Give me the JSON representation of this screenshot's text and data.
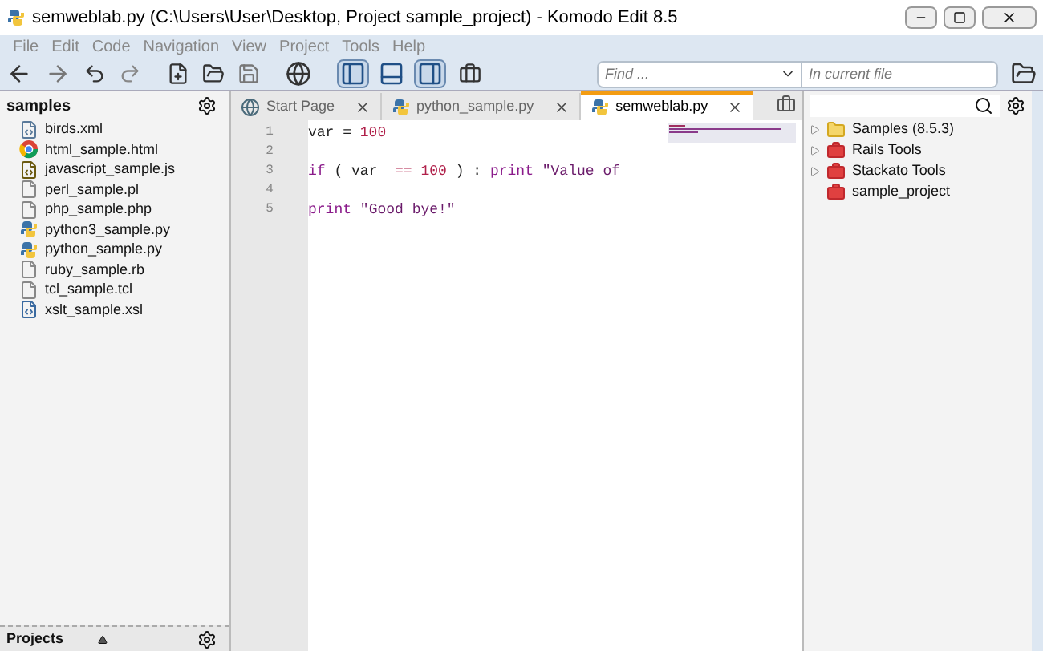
{
  "window": {
    "title": "semweblab.py (C:\\Users\\User\\Desktop, Project sample_project) - Komodo Edit 8.5"
  },
  "menu": [
    "File",
    "Edit",
    "Code",
    "Navigation",
    "View",
    "Project",
    "Tools",
    "Help"
  ],
  "toolbar": {
    "panes": [
      {
        "kind": "left",
        "selected": true
      },
      {
        "kind": "bottom",
        "selected": false
      },
      {
        "kind": "right",
        "selected": true
      }
    ],
    "find": {
      "placeholder": "Find ..."
    },
    "scope": {
      "placeholder": "In current file"
    }
  },
  "left_panel": {
    "title": "samples",
    "files": [
      {
        "name": "birds.xml",
        "kind": "xml"
      },
      {
        "name": "html_sample.html",
        "kind": "html"
      },
      {
        "name": "javascript_sample.js",
        "kind": "js"
      },
      {
        "name": "perl_sample.pl",
        "kind": "plain"
      },
      {
        "name": "php_sample.php",
        "kind": "plain"
      },
      {
        "name": "python3_sample.py",
        "kind": "python"
      },
      {
        "name": "python_sample.py",
        "kind": "python"
      },
      {
        "name": "ruby_sample.rb",
        "kind": "plain"
      },
      {
        "name": "tcl_sample.tcl",
        "kind": "plain"
      },
      {
        "name": "xslt_sample.xsl",
        "kind": "xsl"
      }
    ],
    "footer": "Projects"
  },
  "tabs": [
    {
      "label": "Start Page",
      "kind": "start",
      "selected": false
    },
    {
      "label": "python_sample.py",
      "kind": "python",
      "selected": false
    },
    {
      "label": "semweblab.py",
      "kind": "python",
      "selected": true
    }
  ],
  "editor": {
    "lines": [
      {
        "number": "1",
        "tokens": [
          {
            "text": "var = ",
            "kind": "plain"
          },
          {
            "text": "100",
            "kind": "number"
          }
        ]
      },
      {
        "number": "2"
      },
      {
        "number": "3",
        "tokens": [
          {
            "text": "if",
            "kind": "keyword"
          },
          {
            "text": " ( var  ",
            "kind": "plain"
          },
          {
            "text": "==",
            "kind": "operator"
          },
          {
            "text": " 100",
            "kind": "number"
          },
          {
            "text": " ) : ",
            "kind": "plain"
          },
          {
            "text": "print",
            "kind": "keyword"
          },
          {
            "text": " \"Value of",
            "kind": "string"
          }
        ]
      },
      {
        "number": "4"
      },
      {
        "number": "5",
        "tokens": [
          {
            "text": "print",
            "kind": "keyword"
          },
          {
            "text": " \"Good bye!\"",
            "kind": "string"
          }
        ]
      }
    ]
  },
  "right_panel": {
    "items": [
      {
        "label": "Samples (8.5.3)",
        "kind": "folder",
        "expandable": true
      },
      {
        "label": "Rails Tools",
        "kind": "toolbox",
        "expandable": true
      },
      {
        "label": "Stackato Tools",
        "kind": "toolbox",
        "expandable": true
      },
      {
        "label": "sample_project",
        "kind": "toolbox",
        "expandable": false
      }
    ]
  }
}
